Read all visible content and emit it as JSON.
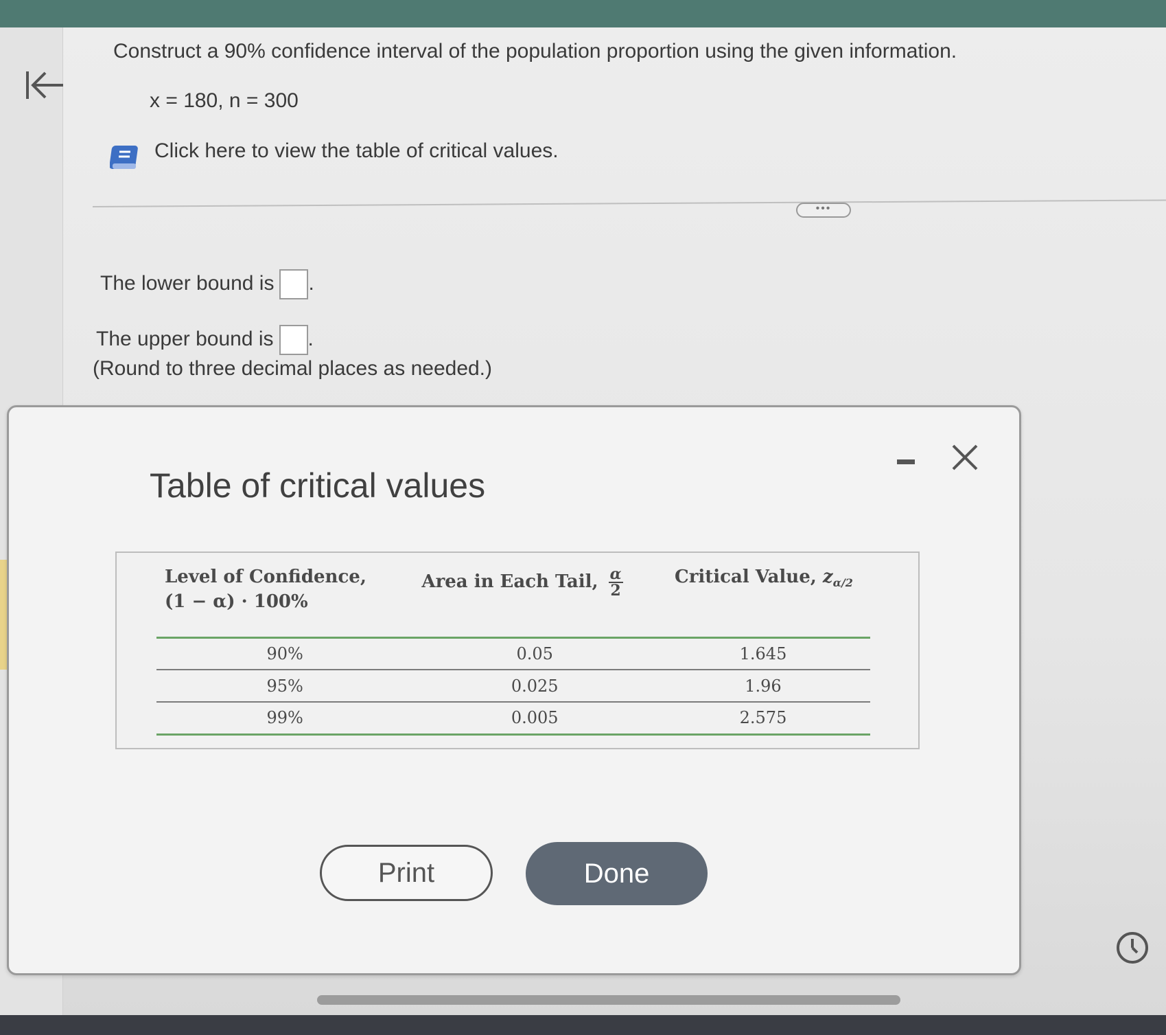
{
  "question": {
    "prompt": "Construct a 90% confidence interval of the population proportion using the given information.",
    "given": "x = 180, n = 300",
    "table_link_label": "Click here to view the table of critical values."
  },
  "more_label": "•••",
  "answers": {
    "lower_label": "The lower bound is",
    "upper_label": "The upper bound is",
    "period": ".",
    "note": "(Round to three decimal places as needed.)"
  },
  "modal": {
    "title": "Table of critical values",
    "table": {
      "headers": {
        "col1_line1": "Level of Confidence,",
        "col1_line2": "(1 − α) · 100%",
        "col2": "Area in Each Tail,",
        "col2_frac_num": "α",
        "col2_frac_den": "2",
        "col3": "Critical Value,",
        "col3_symbol": "z",
        "col3_sub": "α/2"
      },
      "rows": [
        {
          "confidence": "90%",
          "tail": "0.05",
          "critical": "1.645"
        },
        {
          "confidence": "95%",
          "tail": "0.025",
          "critical": "1.96"
        },
        {
          "confidence": "99%",
          "tail": "0.005",
          "critical": "2.575"
        }
      ]
    },
    "print_label": "Print",
    "done_label": "Done"
  },
  "icons": {
    "back": "back-to-start-icon",
    "book": "book-icon",
    "close": "close-icon",
    "minimize": "minimize-icon",
    "clock": "clock-icon"
  },
  "colors": {
    "accent_green": "#6aa466",
    "done_button": "#5f6975",
    "book_blue": "#3d6fc4"
  }
}
